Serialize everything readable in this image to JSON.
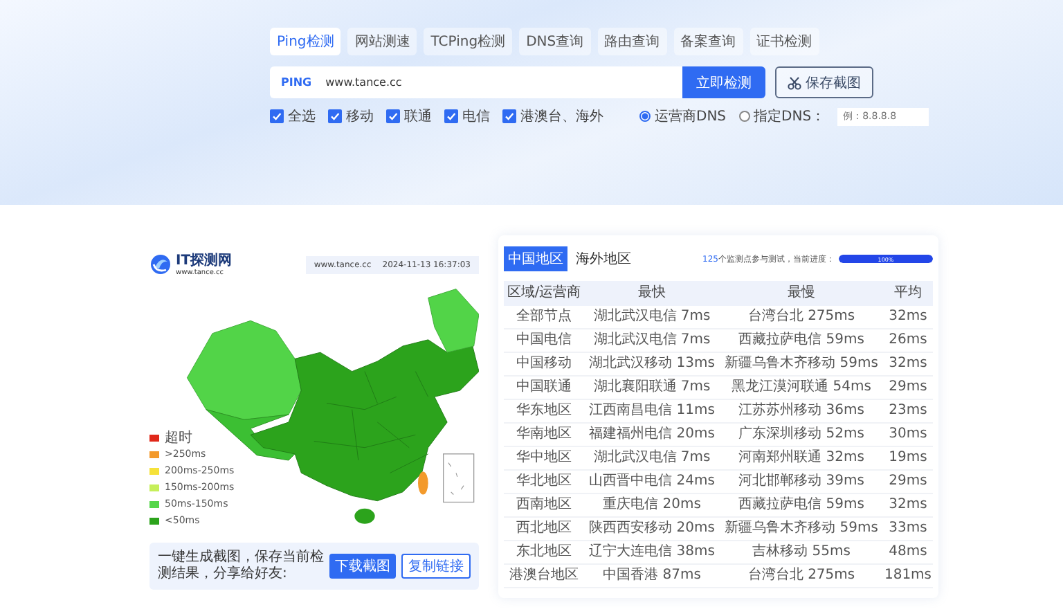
{
  "tool_tabs": [
    {
      "label": "Ping检测",
      "selected": true
    },
    {
      "label": "网站测速",
      "selected": false
    },
    {
      "label": "TCPing检测",
      "selected": false
    },
    {
      "label": "DNS查询",
      "selected": false
    },
    {
      "label": "路由查询",
      "selected": false
    },
    {
      "label": "备案查询",
      "selected": false
    },
    {
      "label": "证书检测",
      "selected": false
    }
  ],
  "search": {
    "prefix": "PING",
    "value": "www.tance.cc",
    "submit": "立即检测",
    "save": "保存截图"
  },
  "filters": [
    {
      "label": "全选",
      "checked": true
    },
    {
      "label": "移动",
      "checked": true
    },
    {
      "label": "联通",
      "checked": true
    },
    {
      "label": "电信",
      "checked": true
    },
    {
      "label": "港澳台、海外",
      "checked": true
    }
  ],
  "dns": {
    "options": [
      {
        "label": "运营商DNS",
        "selected": true
      },
      {
        "label": "指定DNS：",
        "selected": false
      }
    ],
    "placeholder": "例：8.8.8.8"
  },
  "map_card": {
    "logo": "IT探测网",
    "logo_url": "www.tance.cc",
    "site": "www.tance.cc",
    "timestamp": "2024-11-13 16:37:03",
    "legend": [
      {
        "label": "超时",
        "color": "#e0281a"
      },
      {
        "label": ">250ms",
        "color": "#f39a2c"
      },
      {
        "label": "200ms-250ms",
        "color": "#f6e23a"
      },
      {
        "label": "150ms-200ms",
        "color": "#c6ef5a"
      },
      {
        "label": "50ms-150ms",
        "color": "#55d64a"
      },
      {
        "label": "<50ms",
        "color": "#2ca31c"
      }
    ],
    "share": {
      "text": "一键生成截图，保存当前检测结果，分享给好友:",
      "buttons": [
        {
          "label": "下载截图",
          "kind": "primary"
        },
        {
          "label": "复制链接",
          "kind": "outline"
        }
      ]
    }
  },
  "results": {
    "region_tabs": [
      {
        "label": "中国地区",
        "selected": true
      },
      {
        "label": "海外地区",
        "selected": false
      }
    ],
    "count": "125",
    "progress_text": "个监测点参与测试，当前进度：",
    "progress": {
      "level": 1,
      "label": "100%"
    },
    "columns": [
      "区域/运营商",
      "最快",
      "最慢",
      "平均"
    ],
    "rows": [
      [
        "全部节点",
        "湖北武汉电信 7ms",
        "台湾台北 275ms",
        "32ms"
      ],
      [
        "中国电信",
        "湖北武汉电信 7ms",
        "西藏拉萨电信 59ms",
        "26ms"
      ],
      [
        "中国移动",
        "湖北武汉移动 13ms",
        "新疆乌鲁木齐移动 59ms",
        "32ms"
      ],
      [
        "中国联通",
        "湖北襄阳联通 7ms",
        "黑龙江漠河联通 54ms",
        "29ms"
      ],
      [
        "华东地区",
        "江西南昌电信 11ms",
        "江苏苏州移动 36ms",
        "23ms"
      ],
      [
        "华南地区",
        "福建福州电信 20ms",
        "广东深圳移动 52ms",
        "30ms"
      ],
      [
        "华中地区",
        "湖北武汉电信 7ms",
        "河南郑州联通 32ms",
        "19ms"
      ],
      [
        "华北地区",
        "山西晋中电信 24ms",
        "河北邯郸移动 39ms",
        "29ms"
      ],
      [
        "西南地区",
        "重庆电信 20ms",
        "西藏拉萨电信 59ms",
        "32ms"
      ],
      [
        "西北地区",
        "陕西西安移动 20ms",
        "新疆乌鲁木齐移动 59ms",
        "33ms"
      ],
      [
        "东北地区",
        "辽宁大连电信 38ms",
        "吉林移动 55ms",
        "48ms"
      ],
      [
        "港澳台地区",
        "中国香港 87ms",
        "台湾台北 275ms",
        "181ms"
      ]
    ]
  }
}
